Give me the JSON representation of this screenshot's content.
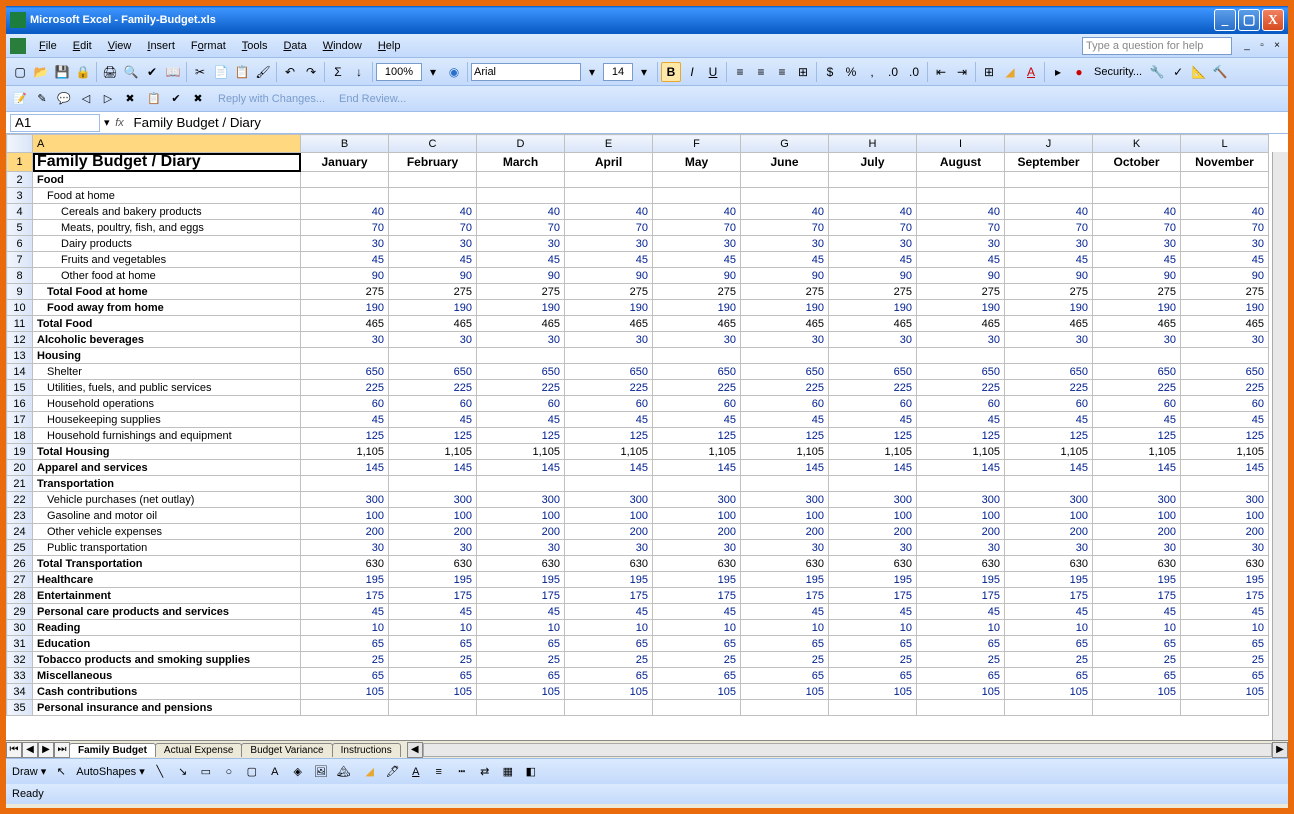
{
  "titlebar": {
    "app": "Microsoft Excel",
    "dash": "  -  ",
    "doc": "Family-Budget.xls"
  },
  "menu": {
    "file": "File",
    "edit": "Edit",
    "view": "View",
    "insert": "Insert",
    "format": "Format",
    "tools": "Tools",
    "data": "Data",
    "window": "Window",
    "help": "Help",
    "helpPlaceholder": "Type a question for help"
  },
  "toolbar": {
    "zoom": "100%",
    "font": "Arial",
    "size": "14",
    "security": "Security..."
  },
  "review": {
    "reply": "Reply with Changes...",
    "end": "End Review..."
  },
  "formula": {
    "cellref": "A1",
    "value": "Family Budget / Diary"
  },
  "columns": [
    "",
    "A",
    "B",
    "C",
    "D",
    "E",
    "F",
    "G",
    "H",
    "I",
    "J",
    "K",
    "L"
  ],
  "months": [
    "January",
    "February",
    "March",
    "April",
    "May",
    "June",
    "July",
    "August",
    "September",
    "October",
    "November"
  ],
  "rows": [
    {
      "n": 1,
      "label": "Family Budget / Diary",
      "header": true
    },
    {
      "n": 2,
      "label": "Food",
      "bold": true
    },
    {
      "n": 3,
      "label": "Food at home",
      "ind": 1
    },
    {
      "n": 4,
      "label": "Cereals and bakery products",
      "ind": 2,
      "v": 40,
      "blue": true
    },
    {
      "n": 5,
      "label": "Meats, poultry, fish, and eggs",
      "ind": 2,
      "v": 70,
      "blue": true
    },
    {
      "n": 6,
      "label": "Dairy products",
      "ind": 2,
      "v": 30,
      "blue": true
    },
    {
      "n": 7,
      "label": "Fruits and vegetables",
      "ind": 2,
      "v": 45,
      "blue": true
    },
    {
      "n": 8,
      "label": "Other food at home",
      "ind": 2,
      "v": 90,
      "blue": true
    },
    {
      "n": 9,
      "label": "Total Food at home",
      "ind": 1,
      "bold": true,
      "v": 275
    },
    {
      "n": 10,
      "label": "Food away from home",
      "ind": 1,
      "bold": true,
      "v": 190,
      "blue": true
    },
    {
      "n": 11,
      "label": "Total Food",
      "bold": true,
      "v": 465
    },
    {
      "n": 12,
      "label": "Alcoholic beverages",
      "bold": true,
      "v": 30,
      "blue": true
    },
    {
      "n": 13,
      "label": "Housing",
      "bold": true
    },
    {
      "n": 14,
      "label": "Shelter",
      "ind": 1,
      "v": 650,
      "blue": true
    },
    {
      "n": 15,
      "label": "Utilities, fuels, and public services",
      "ind": 1,
      "v": 225,
      "blue": true
    },
    {
      "n": 16,
      "label": "Household operations",
      "ind": 1,
      "v": 60,
      "blue": true
    },
    {
      "n": 17,
      "label": "Housekeeping supplies",
      "ind": 1,
      "v": 45,
      "blue": true
    },
    {
      "n": 18,
      "label": "Household furnishings and equipment",
      "ind": 1,
      "v": 125,
      "blue": true
    },
    {
      "n": 19,
      "label": "Total Housing",
      "bold": true,
      "v": "1,105"
    },
    {
      "n": 20,
      "label": "Apparel and services",
      "bold": true,
      "v": 145,
      "blue": true
    },
    {
      "n": 21,
      "label": "Transportation",
      "bold": true
    },
    {
      "n": 22,
      "label": "Vehicle purchases (net outlay)",
      "ind": 1,
      "v": 300,
      "blue": true
    },
    {
      "n": 23,
      "label": "Gasoline and motor oil",
      "ind": 1,
      "v": 100,
      "blue": true
    },
    {
      "n": 24,
      "label": "Other vehicle expenses",
      "ind": 1,
      "v": 200,
      "blue": true
    },
    {
      "n": 25,
      "label": "Public transportation",
      "ind": 1,
      "v": 30,
      "blue": true
    },
    {
      "n": 26,
      "label": "Total Transportation",
      "bold": true,
      "v": 630
    },
    {
      "n": 27,
      "label": "Healthcare",
      "bold": true,
      "v": 195,
      "blue": true
    },
    {
      "n": 28,
      "label": "Entertainment",
      "bold": true,
      "v": 175,
      "blue": true
    },
    {
      "n": 29,
      "label": "Personal care products and services",
      "bold": true,
      "v": 45,
      "blue": true
    },
    {
      "n": 30,
      "label": "Reading",
      "bold": true,
      "v": 10,
      "blue": true
    },
    {
      "n": 31,
      "label": "Education",
      "bold": true,
      "v": 65,
      "blue": true
    },
    {
      "n": 32,
      "label": "Tobacco products and smoking supplies",
      "bold": true,
      "v": 25,
      "blue": true
    },
    {
      "n": 33,
      "label": "Miscellaneous",
      "bold": true,
      "v": 65,
      "blue": true
    },
    {
      "n": 34,
      "label": "Cash contributions",
      "bold": true,
      "v": 105,
      "blue": true
    },
    {
      "n": 35,
      "label": "Personal insurance and pensions",
      "bold": true
    }
  ],
  "tabs": [
    "Family Budget",
    "Actual Expense",
    "Budget Variance",
    "Instructions"
  ],
  "draw": {
    "draw": "Draw",
    "autoshapes": "AutoShapes"
  },
  "status": "Ready"
}
